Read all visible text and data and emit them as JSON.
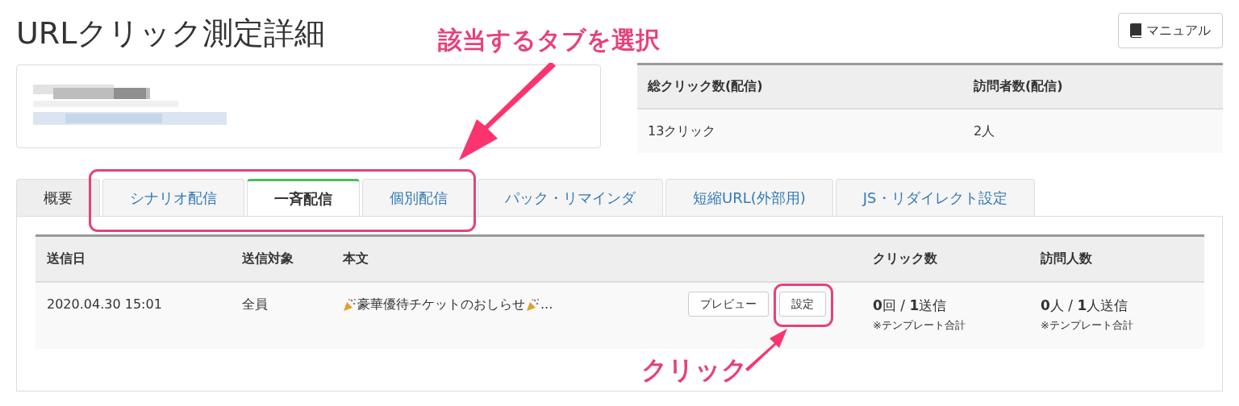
{
  "title": "URLクリック測定詳細",
  "manual_button": {
    "label": "マニュアル"
  },
  "summary": {
    "columns": [
      "総クリック数(配信)",
      "訪問者数(配信)"
    ],
    "values": [
      "13クリック",
      "2人"
    ]
  },
  "tabs": [
    {
      "label": "概要",
      "kind": "plain",
      "selected": false
    },
    {
      "label": "シナリオ配信",
      "kind": "link",
      "selected": false
    },
    {
      "label": "一斉配信",
      "kind": "link",
      "selected": true
    },
    {
      "label": "個別配信",
      "kind": "link",
      "selected": false
    },
    {
      "label": "パック・リマインダ",
      "kind": "link",
      "selected": false
    },
    {
      "label": "短縮URL(外部用)",
      "kind": "link",
      "selected": false
    },
    {
      "label": "JS・リダイレクト設定",
      "kind": "link",
      "selected": false
    }
  ],
  "table": {
    "columns": [
      "送信日",
      "送信対象",
      "本文",
      "",
      "クリック数",
      "訪問人数"
    ],
    "rows": [
      {
        "date": "2020.04.30 15:01",
        "target": "全員",
        "body": "豪華優待チケットのおしらせ",
        "body_suffix": "...",
        "buttons": [
          "プレビュー",
          "設定"
        ],
        "clicks": "**0**回 / **1**送信",
        "clicks_note": "※テンプレート合計",
        "visits": "**0**人 / **1**人送信",
        "visits_note": "※テンプレート合計"
      }
    ]
  },
  "annotations": [
    {
      "text": "該当するタブを選択"
    },
    {
      "text": "クリック"
    }
  ]
}
